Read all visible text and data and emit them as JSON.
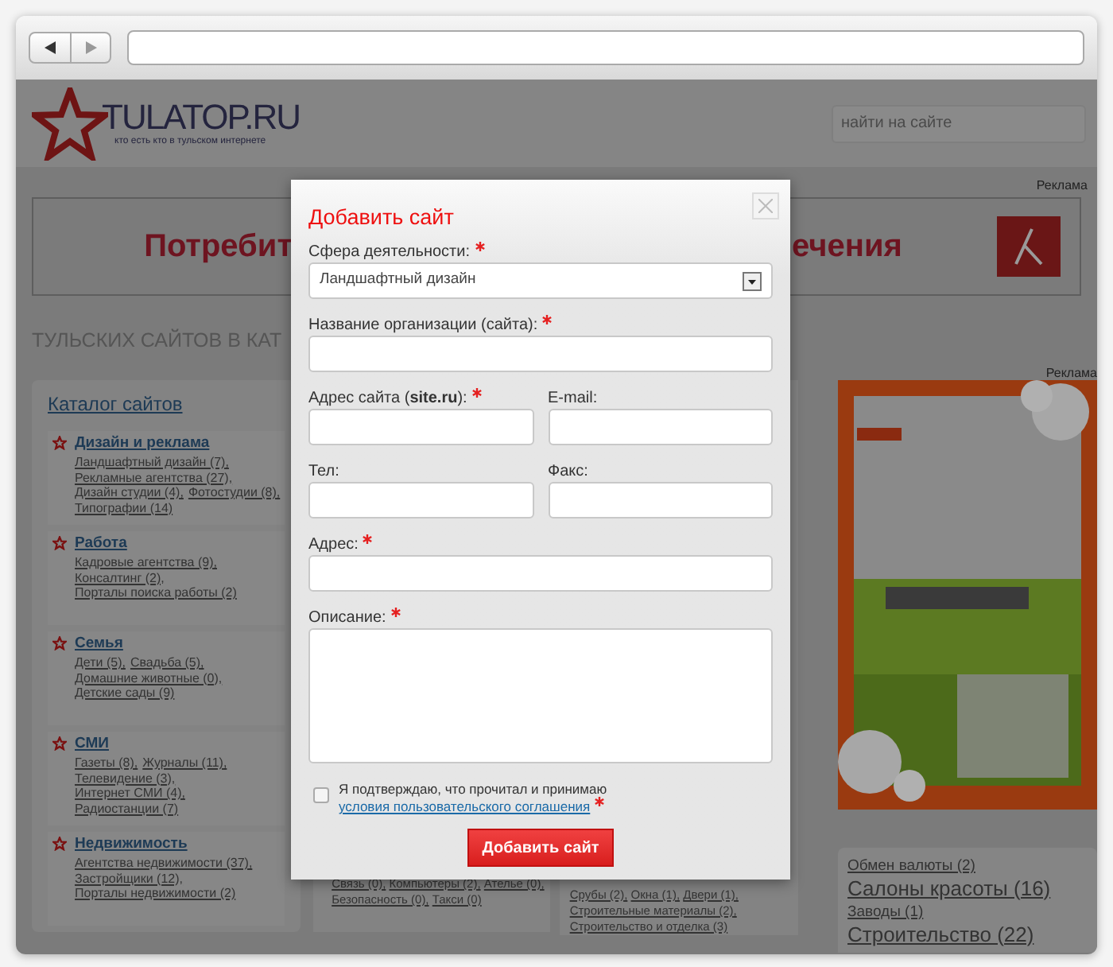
{
  "site": {
    "logo": {
      "name": "TULATOP.RU",
      "tagline": "кто есть кто в тульском интернете"
    },
    "search": {
      "placeholder": "найти на сайте"
    },
    "banner": {
      "label": "Реклама",
      "text_left": "Потребит",
      "text_right": "ечения"
    },
    "heading": "ТУЛЬСКИХ САЙТОВ В КАТ",
    "catalog": {
      "title": "Каталог сайтов",
      "categories": [
        {
          "name": "Дизайн и реклама",
          "items": [
            "Ландшафтный дизайн (7),",
            "Рекламные агентства (27),",
            "Дизайн студии (4),",
            "Фотостудии (8),",
            "Типографии (14)"
          ]
        },
        {
          "name": "Работа",
          "items": [
            "Кадровые агентства (9),",
            "Консалтинг (2),",
            "Порталы поиска работы (2)"
          ]
        },
        {
          "name": "Семья",
          "items": [
            "Дети (5),",
            "Свадьба (5),",
            "Домашние животные (0),",
            "Детские сады (9)"
          ]
        },
        {
          "name": "СМИ",
          "items": [
            "Газеты (8),",
            "Журналы (11),",
            "Телевидение (3),",
            "Интернет СМИ (4),",
            "Радиостанции (7)"
          ]
        },
        {
          "name": "Недвижимость",
          "items": [
            "Агентства недвижимости (37),",
            "Застройщики (12),",
            "Порталы недвижимости (2)"
          ]
        }
      ]
    },
    "column_2": {
      "items": [
        "Связь (0),",
        "Компьютеры (2),",
        "Ателье (0),",
        "Безопасность (0),",
        "Такси (0)"
      ]
    },
    "column_3": {
      "items": [
        "Срубы (2),",
        "Окна (1),",
        "Двери (1),",
        "Строительные материалы (2),",
        "Строительство и отделка (3)"
      ]
    },
    "side_ad": {
      "label": "Реклама"
    },
    "tag_cloud": [
      {
        "label": "Обмен валюты (2)",
        "kind": "small"
      },
      {
        "label": "Салоны красоты (16)",
        "kind": "large"
      },
      {
        "label": "Заводы (1)",
        "kind": "small"
      },
      {
        "label": "Строительство (22)",
        "kind": "large"
      }
    ]
  },
  "dialog": {
    "title": "Добавить сайт",
    "rows": [
      {
        "fields": [
          {
            "label": "Сфера деятельности:",
            "required": true,
            "kind": "select",
            "value": "Ландшафтный дизайн"
          }
        ]
      },
      {
        "fields": [
          {
            "label": "Название организации (сайта):",
            "required": true,
            "kind": "text"
          }
        ]
      },
      {
        "fields": [
          {
            "label": "Адрес сайта (**site.ru**):",
            "required": true,
            "kind": "text"
          },
          {
            "label": "E-mail:",
            "required": false,
            "kind": "text"
          }
        ]
      },
      {
        "fields": [
          {
            "label": "Тел:",
            "required": false,
            "kind": "text"
          },
          {
            "label": "Факс:",
            "required": false,
            "kind": "text"
          }
        ]
      },
      {
        "fields": [
          {
            "label": "Адрес:",
            "required": true,
            "kind": "text"
          }
        ]
      },
      {
        "fields": [
          {
            "label": "Описание:",
            "required": true,
            "kind": "textarea"
          }
        ]
      }
    ],
    "agreement": {
      "checked": false,
      "text": "Я подтверждаю, что прочитал и принимаю",
      "link": "условия пользовательского соглашения",
      "required": true
    },
    "submit": "Добавить сайт"
  }
}
